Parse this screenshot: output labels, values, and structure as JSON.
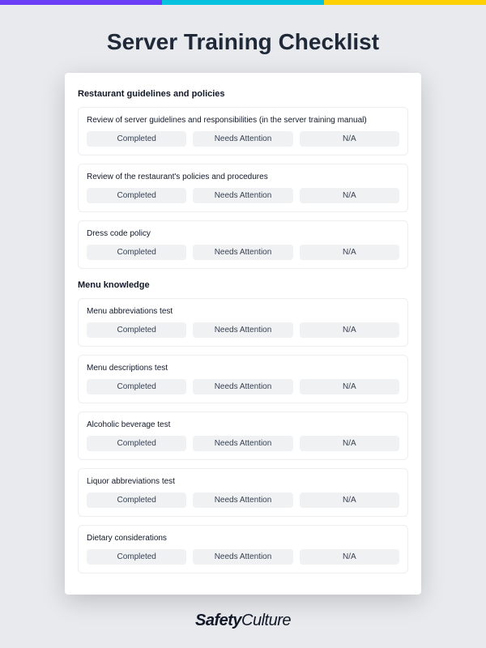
{
  "title": "Server Training Checklist",
  "footer": {
    "brand_bold": "Safety",
    "brand_light": "Culture"
  },
  "options": {
    "completed": "Completed",
    "needs_attention": "Needs Attention",
    "na": "N/A"
  },
  "sections": [
    {
      "title": "Restaurant guidelines and policies",
      "items": [
        "Review of server guidelines and responsibilities (in the server training manual)",
        "Review of the restaurant's policies and procedures",
        "Dress code policy"
      ]
    },
    {
      "title": "Menu knowledge",
      "items": [
        "Menu abbreviations test",
        "Menu descriptions test",
        "Alcoholic beverage test",
        "Liquor abbreviations test",
        "Dietary considerations"
      ]
    }
  ]
}
